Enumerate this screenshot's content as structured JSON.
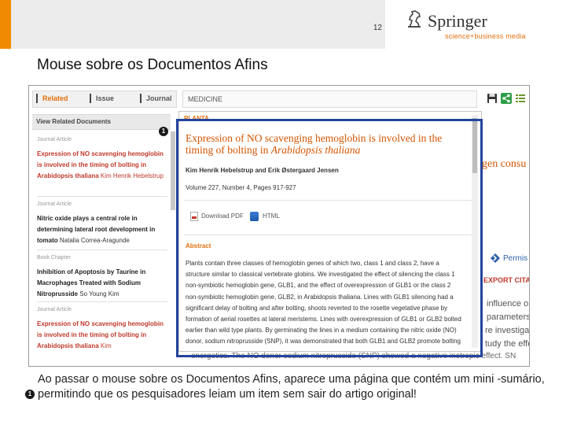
{
  "slide": {
    "page_number": "12",
    "title": "Mouse sobre os Documentos Afins",
    "caption": "Ao passar o mouse sobre os Documentos Afins, aparece uma  página que contém um mini -sumário, permitindo que os pesquisadores leiam um item sem sair do artigo original!",
    "marker": "1"
  },
  "logo": {
    "name": "Springer",
    "tagline": "science+business media"
  },
  "colors": {
    "accent_orange": "#f08a00",
    "link_red": "#c0392b",
    "highlight_blue": "#24449c"
  },
  "tabs": [
    "Related",
    "Issue",
    "Journal"
  ],
  "search": {
    "value": "MEDICINE"
  },
  "toolbar_icons": [
    "save-icon",
    "share-icon",
    "list-icon"
  ],
  "sidebar": {
    "header": "View Related Documents",
    "items": [
      {
        "type": "Journal Article",
        "title": "Expression of NO scavenging hemoglobin is involved in the timing of bolting in Arabidopsis thaliana",
        "author": "Kim Henrik Hebelstrup"
      },
      {
        "type": "Journal Article",
        "title": "Nitric oxide plays a central role in determining lateral root development in tomato",
        "author": "Natalia Correa-Aragunde"
      },
      {
        "type": "Book Chapter",
        "title": "Inhibition of Apoptosis by Taurine in Macrophages Treated with Sodium Nitroprusside",
        "author": "So Young Kim"
      },
      {
        "type": "Journal Article",
        "title": "Expression of NO scavenging hemoglobin is involved in the timing of bolting in Arabidopsis thaliana",
        "author": "Kim"
      }
    ]
  },
  "popup": {
    "label": "PLANTA",
    "title_prefix": "Expression of NO scavenging hemoglobin is involved in the timing of bolting in ",
    "title_italic": "Arabidopsis thaliana",
    "authors": "Kim Henrik Hebelstrup and Erik Østergaard Jensen",
    "volume": "Volume 227, Number 4, Pages 917-927",
    "download_pdf": "Download PDF",
    "html": "HTML",
    "abstract_heading": "Abstract",
    "abstract": "Plants contain three classes of hemoglobin genes of which two, class 1 and class 2, have a structure similar to classical vertebrate globins. We investigated the effect of silencing the class 1 non-symbiotic hemoglobin gene, GLB1, and the effect of overexpression of GLB1 or the class 2 non-symbiotic hemoglobin gene, GLB2, in Arabidopsis thaliana. Lines with GLB1 silencing had a significant delay of bolting and after bolting, shoots reverted to the rosette vegetative phase by formation of aerial rosettes at lateral meristems. Lines with overexpression of GLB1 or GLB2 bolted earlier than wild type plants. By germinating the lines in a medium containing the nitric oxide (NO) donor, sodium nitroprusside (SNP), it was demonstrated that both GLB1 and GLB2 promote bolting"
  },
  "background_article": {
    "title_fragment": "gen consu",
    "permissions": "Permis",
    "export": "EXPORT CITA",
    "text_lines": [
      "influence o",
      "parameters",
      "re investigat",
      "tudy the effe",
      "pic effect. SN"
    ],
    "bottom_line": "energetics. The NO donor sodium nitroprusside (SNP) showed a negative inotropic effect. SN"
  }
}
